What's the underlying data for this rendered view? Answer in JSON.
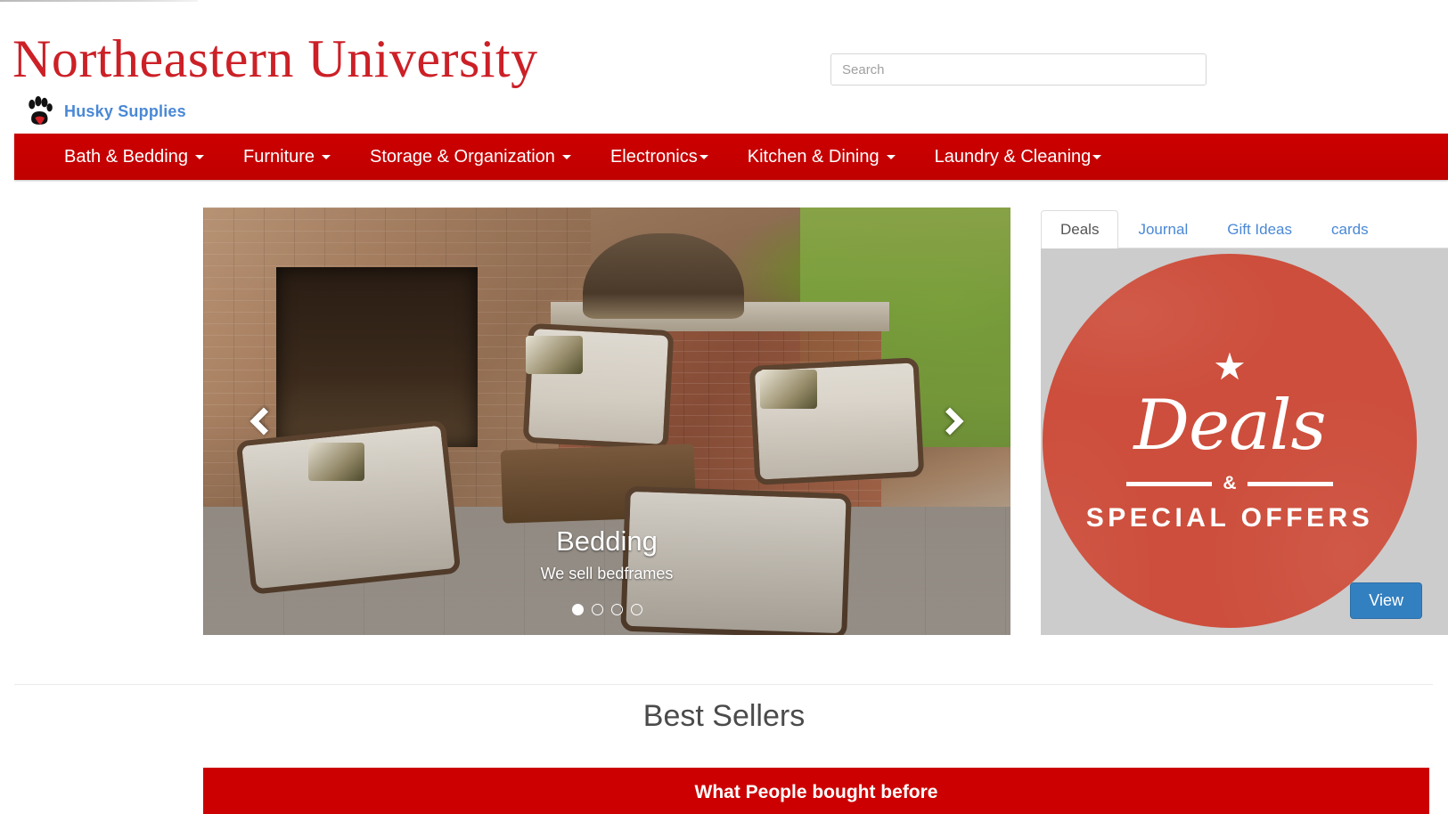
{
  "header": {
    "wordmark": "Northeastern University",
    "sub_brand": "Husky Supplies",
    "paw_icon": "paw-print-icon",
    "search": {
      "placeholder": "Search",
      "value": ""
    }
  },
  "nav": {
    "background_color": "#cc0000",
    "items": [
      {
        "label": "Bath & Bedding",
        "has_caret": true
      },
      {
        "label": "Furniture",
        "has_caret": true
      },
      {
        "label": "Storage & Organization",
        "has_caret": true
      },
      {
        "label": "Electronics",
        "has_caret": true
      },
      {
        "label": "Kitchen & Dining",
        "has_caret": true
      },
      {
        "label": "Laundry & Cleaning",
        "has_caret": true
      }
    ]
  },
  "carousel": {
    "slide_title": "Bedding",
    "slide_subtitle": "We sell bedframes",
    "prev_icon": "chevron-left-icon",
    "next_icon": "chevron-right-icon",
    "indicator_count": 4,
    "active_indicator": 1
  },
  "side_panel": {
    "tabs": [
      {
        "label": "Deals",
        "active": true
      },
      {
        "label": "Journal",
        "active": false
      },
      {
        "label": "Gift Ideas",
        "active": false
      },
      {
        "label": "cards",
        "active": false
      }
    ],
    "deals_badge": {
      "star_glyph": "★",
      "script_text": "Deals",
      "ampersand": "&",
      "offers_text": "SPECIAL OFFERS",
      "circle_color": "#cd4e3c",
      "pane_background": "#cccccc"
    },
    "view_button": {
      "label": "View",
      "color": "#3380c0"
    }
  },
  "main": {
    "section_title": "Best Sellers",
    "bestsellers_bar": {
      "label": "What People bought before",
      "color": "#cc0000"
    }
  }
}
